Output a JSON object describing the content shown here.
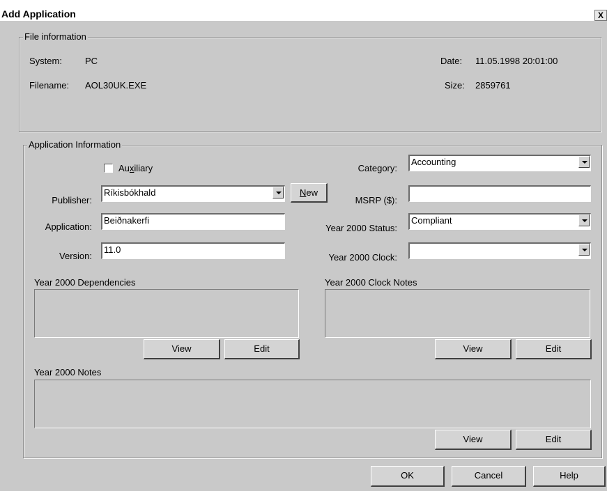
{
  "window": {
    "title": "Add Application",
    "close_glyph": "X"
  },
  "file_info": {
    "group_title": "File information",
    "system_label": "System:",
    "system_value": "PC",
    "filename_label": "Filename:",
    "filename_value": "AOL30UK.EXE",
    "date_label": "Date:",
    "date_value": "11.05.1998 20:01:00",
    "size_label": "Size:",
    "size_value": "2859761"
  },
  "app_info": {
    "group_title": "Application Information",
    "auxiliary_label_pre": "Au",
    "auxiliary_label_u": "x",
    "auxiliary_label_post": "iliary",
    "auxiliary_checked": false,
    "publisher_label": "Publisher:",
    "publisher_value": "Ríkisbókhald",
    "new_button_u": "N",
    "new_button_rest": "ew",
    "application_label": "Application:",
    "application_value": "Beiðnakerfi",
    "version_label": "Version:",
    "version_value": "11.0",
    "category_label": "Category:",
    "category_value": "Accounting",
    "msrp_label": "MSRP ($):",
    "msrp_value": "",
    "y2k_status_label": "Year 2000 Status:",
    "y2k_status_value": "Compliant",
    "y2k_clock_label": "Year 2000 Clock:",
    "y2k_clock_value": "",
    "dependencies_label": "Year 2000 Dependencies",
    "clock_notes_label": "Year 2000 Clock Notes",
    "notes_label": "Year 2000 Notes",
    "view_label": "View",
    "edit_label": "Edit"
  },
  "footer": {
    "ok_label": "OK",
    "cancel_label": "Cancel",
    "help_label": "Help"
  }
}
